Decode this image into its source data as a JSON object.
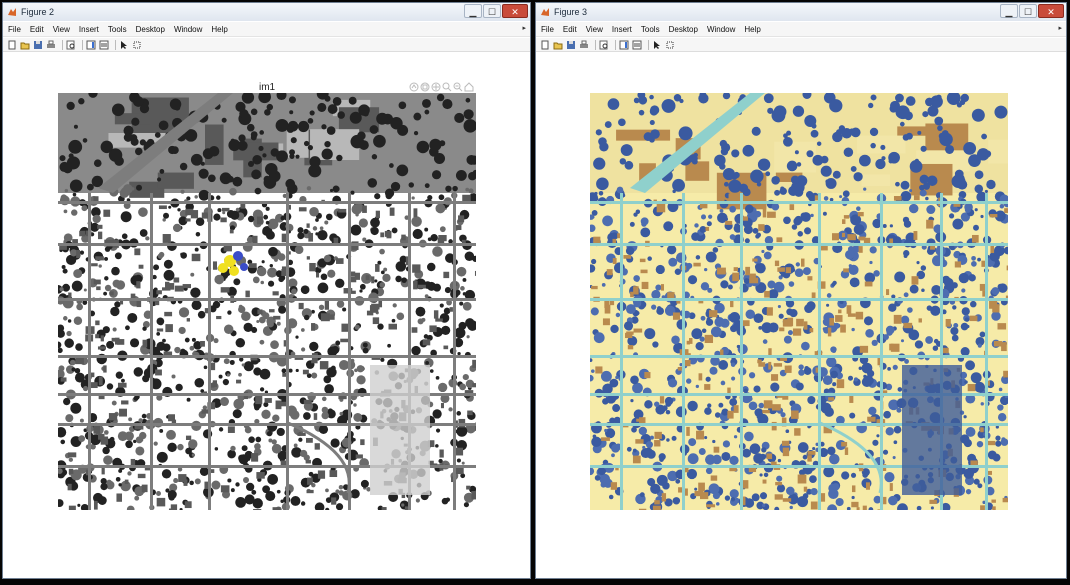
{
  "windows": [
    {
      "title": "Figure 2",
      "menu": [
        "File",
        "Edit",
        "View",
        "Insert",
        "Tools",
        "Desktop",
        "Window",
        "Help"
      ],
      "axes_title": "im1"
    },
    {
      "title": "Figure 3",
      "menu": [
        "File",
        "Edit",
        "View",
        "Insert",
        "Tools",
        "Desktop",
        "Window",
        "Help"
      ],
      "axes_title": ""
    }
  ],
  "toolbar_icons": [
    "new-figure-icon",
    "open-file-icon",
    "save-icon",
    "print-icon",
    "print-preview-icon",
    "colorbar-icon",
    "legend-icon",
    "pointer-icon",
    "edit-plot-icon"
  ],
  "axes_toolbar_icons": [
    "export-icon",
    "brush-icon",
    "pan-icon",
    "zoom-in-icon",
    "zoom-out-icon",
    "home-icon"
  ],
  "colors": {
    "highlight_yellow": "#f0e020",
    "highlight_blue": "#3a4cc8",
    "parula_brown": "#b98a4e",
    "parula_cream": "#f6eba8",
    "parula_blue": "#3a5aa0",
    "parula_cyan": "#8fd0cc"
  }
}
